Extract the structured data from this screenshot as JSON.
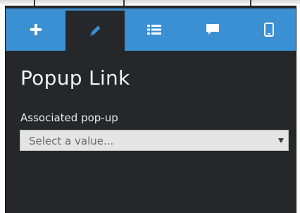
{
  "tabs": [
    {
      "icon": "plus-icon",
      "active": false
    },
    {
      "icon": "pencil-icon",
      "active": true
    },
    {
      "icon": "list-icon",
      "active": false
    },
    {
      "icon": "comment-icon",
      "active": false
    },
    {
      "icon": "mobile-icon",
      "active": false
    }
  ],
  "panel": {
    "title": "Popup Link",
    "field_label": "Associated pop-up",
    "select_value": "Select a value..."
  },
  "colors": {
    "accent": "#3b8fd3",
    "panel_bg": "#26272b",
    "select_bg": "#e4e4e4"
  }
}
